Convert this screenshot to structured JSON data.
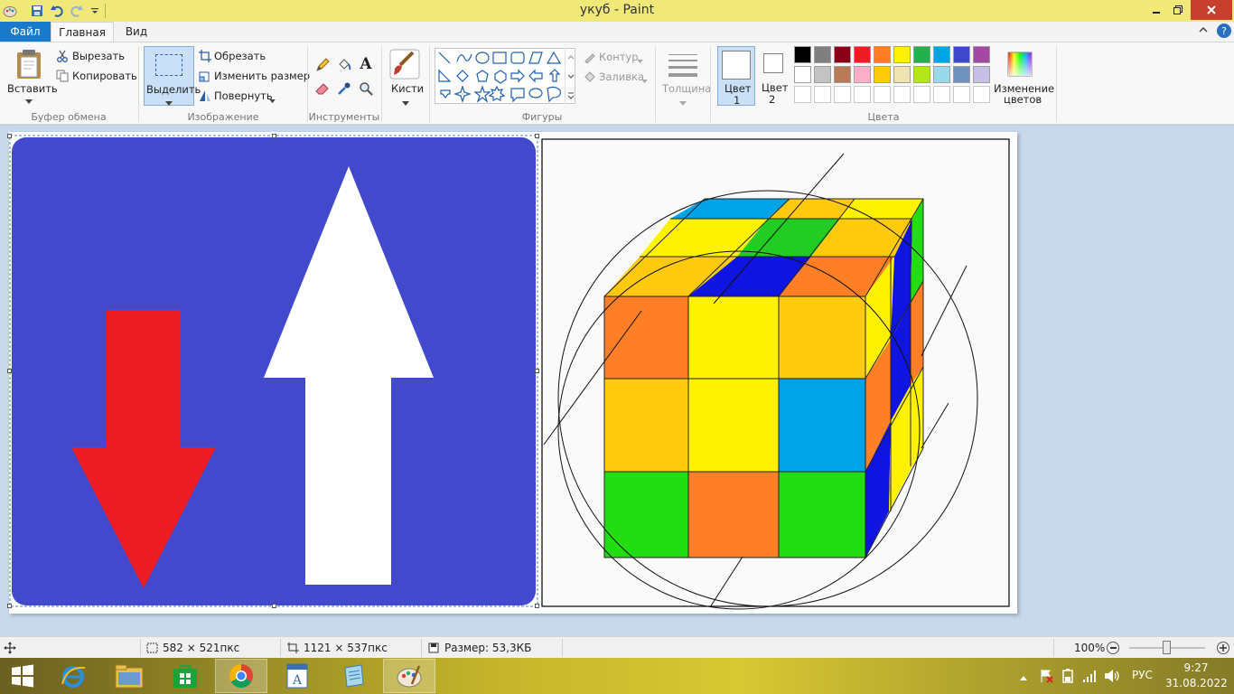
{
  "window": {
    "title": "укуб - Paint"
  },
  "tabs": {
    "file": "Файл",
    "home": "Главная",
    "view": "Вид"
  },
  "clipboard": {
    "paste": "Вставить",
    "cut": "Вырезать",
    "copy": "Копировать",
    "label": "Буфер обмена"
  },
  "image": {
    "select": "Выделить",
    "crop": "Обрезать",
    "resize": "Изменить размер",
    "rotate": "Повернуть",
    "label": "Изображение"
  },
  "tools": {
    "label": "Инструменты",
    "text_glyph": "A"
  },
  "brushes": {
    "label": "Кисти"
  },
  "shapes": {
    "outline": "Контур",
    "fill": "Заливка",
    "label": "Фигуры"
  },
  "size": {
    "label": "Толщина"
  },
  "colors": {
    "color1_line1": "Цвет",
    "color1_line2": "1",
    "color2_line1": "Цвет",
    "color2_line2": "2",
    "edit_line1": "Изменение",
    "edit_line2": "цветов",
    "label": "Цвета",
    "palette_row1": [
      "#000000",
      "#7f7f7f",
      "#880015",
      "#ed1c24",
      "#ff7f27",
      "#fff200",
      "#22b14c",
      "#00a2e8",
      "#3f48cc",
      "#a349a4"
    ],
    "palette_row2": [
      "#ffffff",
      "#c3c3c3",
      "#b97a57",
      "#ffaec9",
      "#ffc90e",
      "#efe4b0",
      "#b5e61d",
      "#99d9ea",
      "#7092be",
      "#c8bfe7"
    ],
    "color1": "#ffffff",
    "color2": "#ffffff"
  },
  "status": {
    "selection_size": "582 × 521пкс",
    "image_size": "1121 × 537пкс",
    "file_size": "Размер: 53,3КБ",
    "zoom": "100%"
  },
  "taskbar": {
    "lang": "РУС",
    "time": "9:27",
    "date": "31.08.2022"
  }
}
